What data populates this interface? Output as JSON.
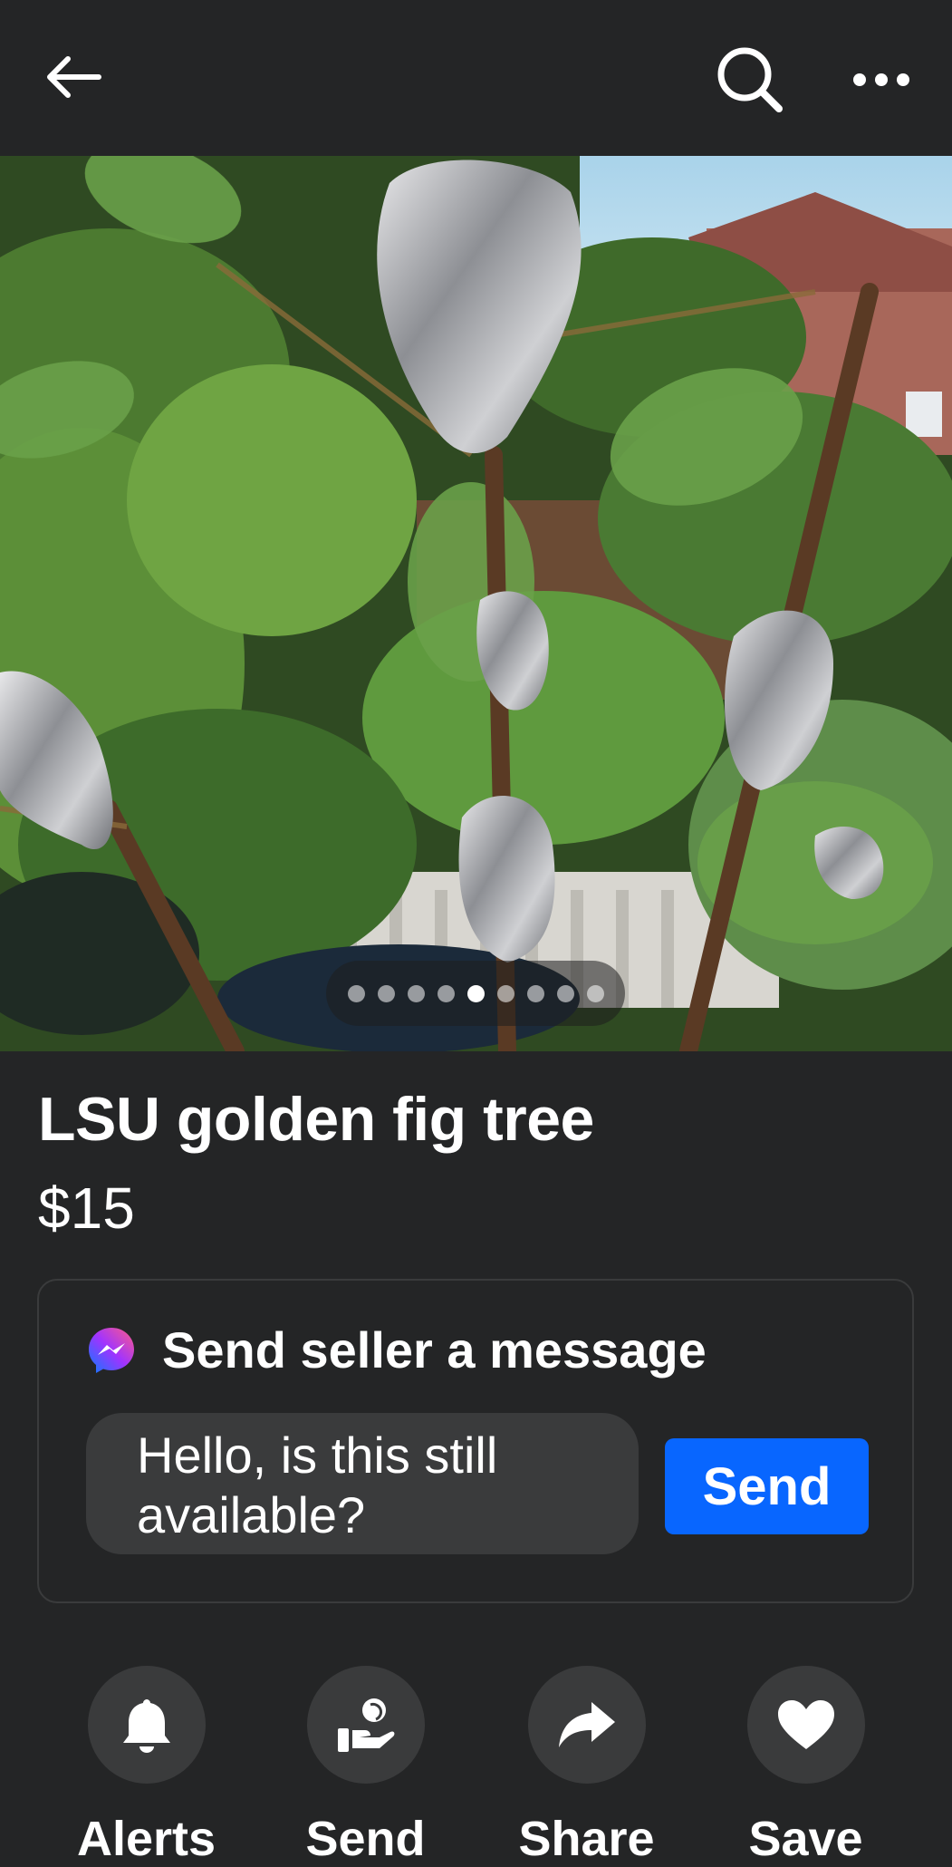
{
  "listing": {
    "title": "LSU golden fig tree",
    "price": "$15",
    "photo": {
      "count": 9,
      "current": 5
    }
  },
  "message": {
    "header": "Send seller a message",
    "input_value": "Hello, is this still available?",
    "send_label": "Send"
  },
  "actions": [
    {
      "label": "Alerts",
      "icon": "bell-icon"
    },
    {
      "label": "Send",
      "icon": "send-to-friend-icon"
    },
    {
      "label": "Share",
      "icon": "share-arrow-icon"
    },
    {
      "label": "Save",
      "icon": "heart-icon"
    }
  ],
  "colors": {
    "background": "#242526",
    "surface": "#3a3b3c",
    "accent": "#0866ff",
    "text": "#ffffff"
  }
}
